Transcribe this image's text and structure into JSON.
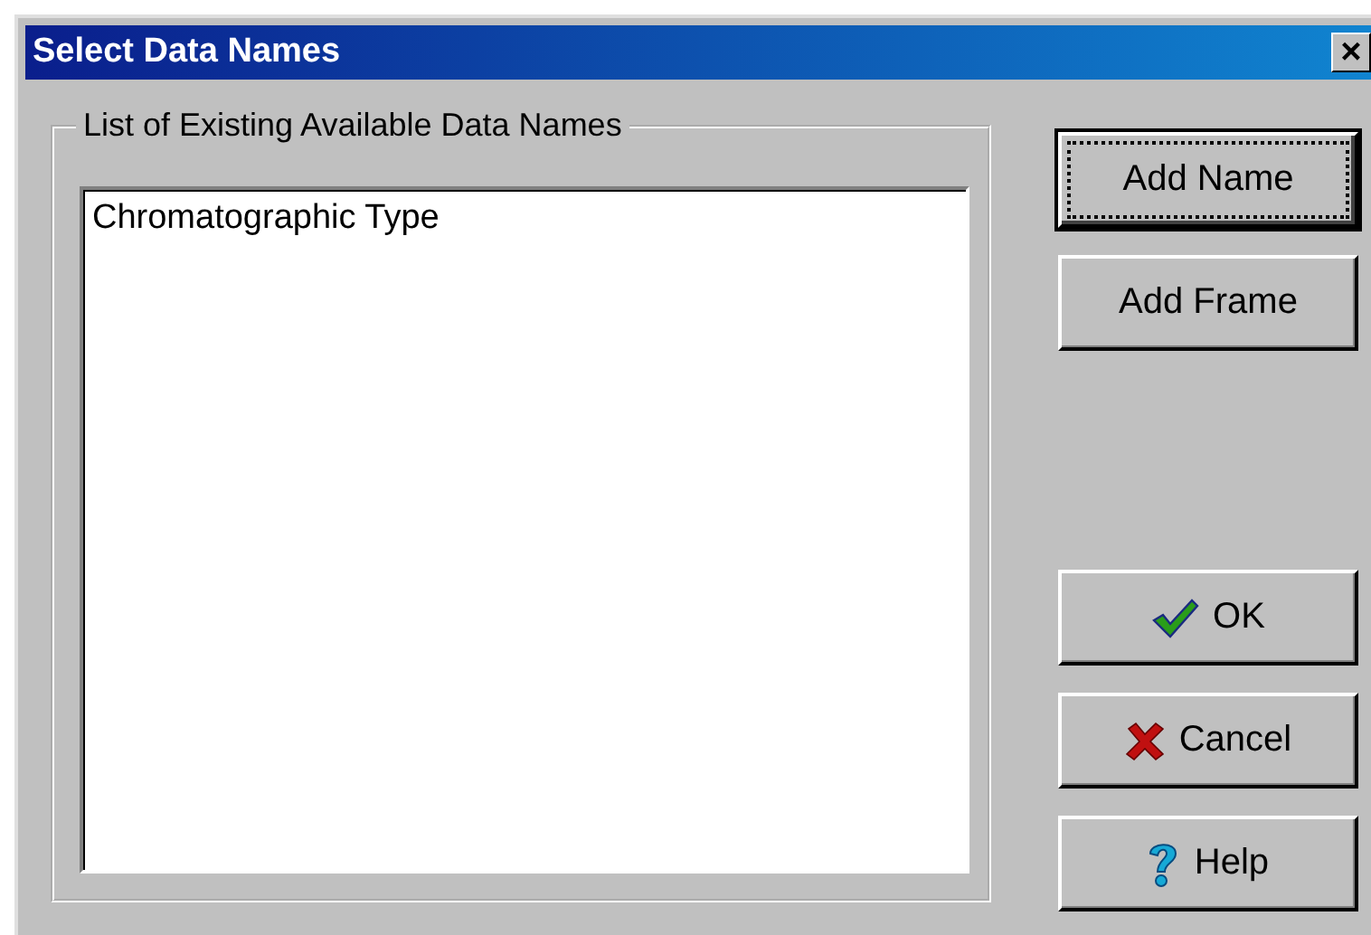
{
  "window": {
    "title": "Select Data Names",
    "close": "×"
  },
  "group": {
    "label": "List of Existing Available Data Names"
  },
  "list": {
    "items": [
      {
        "label": "Chromatographic Type",
        "selected": false
      }
    ]
  },
  "buttons_top": [
    {
      "label": "Add Name",
      "focused": true
    },
    {
      "label": "Add Frame",
      "focused": false
    }
  ],
  "buttons_bottom": [
    {
      "label": "OK",
      "focused": false,
      "kind": "confirm"
    },
    {
      "label": "Cancel",
      "focused": false,
      "kind": "cancel"
    },
    {
      "label": "Help",
      "focused": false,
      "kind": "help"
    }
  ]
}
